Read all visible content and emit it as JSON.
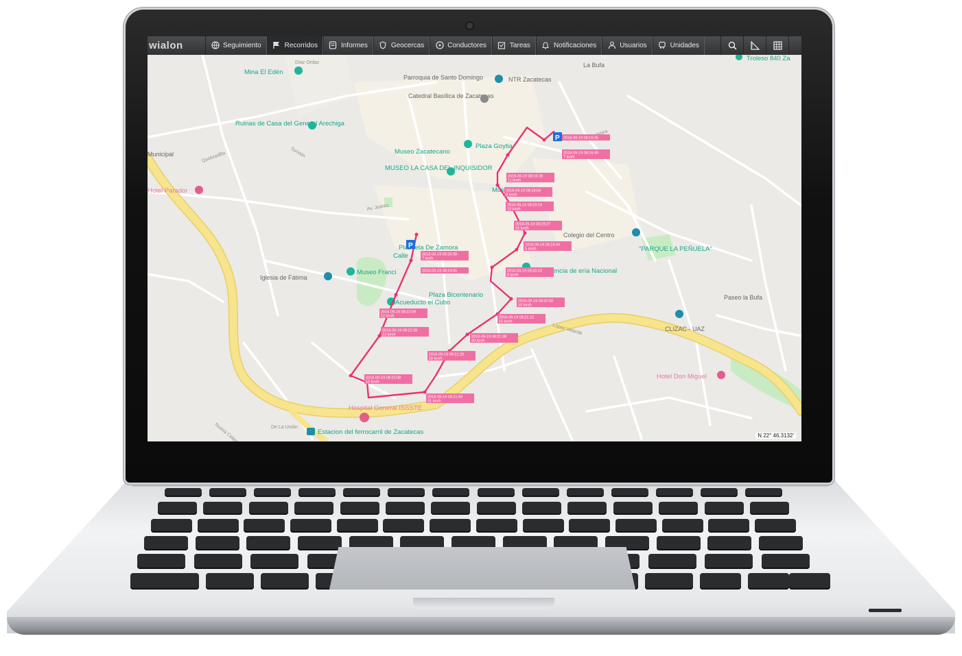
{
  "app": {
    "logo": "wialon",
    "nav": [
      {
        "label": "Seguimiento",
        "icon": "globe-icon",
        "active": false
      },
      {
        "label": "Recorridos",
        "icon": "flag-icon",
        "active": true
      },
      {
        "label": "Informes",
        "icon": "report-icon",
        "active": false
      },
      {
        "label": "Geocercas",
        "icon": "geofence-icon",
        "active": false
      },
      {
        "label": "Conductores",
        "icon": "driver-icon",
        "active": false
      },
      {
        "label": "Tareas",
        "icon": "task-icon",
        "active": false
      },
      {
        "label": "Notificaciones",
        "icon": "bell-icon",
        "active": false
      },
      {
        "label": "Usuarios",
        "icon": "user-icon",
        "active": false
      },
      {
        "label": "Unidades",
        "icon": "car-icon",
        "active": false
      }
    ],
    "tools": [
      "search-icon",
      "ruler-icon",
      "grid-icon"
    ],
    "colors": {
      "topbar": "#3a3b3d",
      "track": "#e8336f",
      "stamp": "#f06fa3",
      "road": "#f6e08a",
      "park": "#c9ebc3"
    }
  },
  "map": {
    "coordinate": "N 22° 46.3132'",
    "places": {
      "mina": "Mina El Edén",
      "diaz": "Díaz Ordaz",
      "parroquia": "Parroquia de Santo Domingo",
      "ntr": "NTR Zacatecas",
      "catedral": "Catedral Basílica de Zacatecas",
      "la_bufa": "La Bufa",
      "troleso": "Troleso 840 Za",
      "ruinas": "Ruinas de Casa del General Arechiga",
      "museo_zac": "Museo Zacatecano",
      "plaza_goytia": "Plaza Goytia",
      "museo_inq": "MUSEO LA CASA DEL INQUISIDOR",
      "museo_botica": "Museo de la Botica",
      "hotel_parador": "Hotel Parador",
      "municipal": "Municipal",
      "quebradilla": "Quebradilla",
      "torreon": "Torreón",
      "av_juarez": "Av. Juárez",
      "colegio": "Colegio del Centro",
      "parque": "\"PARQUE LA PEÑUELA\"",
      "plazuela": "Plazuela De Zamora",
      "calle": "Calle",
      "iglesia": "Iglesia de Fátima",
      "museo_fran": "Museo Franci",
      "agencia": "Agencia de ería Nacional",
      "plaza_bic": "Plaza Bicentenario",
      "acueducto": "Acueducto el Cubo",
      "paseo_bufa": "Paseo la Bufa",
      "clizac": "CLIZAC - UAZ",
      "hotel_miguel": "Hotel Don Miguel",
      "hospital": "Hospital General ISSSTE",
      "estacion": "Estacion del ferrocarril de Zacatecas",
      "la_union": "De La Unión",
      "nueva_celaya": "Nueva Celaya",
      "velarde": "López Velarde",
      "alterpalmira": "Altapalmira",
      "la_bufa_paseo": "Paseo la Bufa"
    },
    "stamps": [
      {
        "t": "2018-09-19 08:16:35",
        "s": ""
      },
      {
        "t": "2018-09-19 08:16:49",
        "s": "7 km/h"
      },
      {
        "t": "2018-09-19 08:16:28",
        "s": "11 km/h"
      },
      {
        "t": "2018-09-19 08:18:54",
        "s": "9 km/h"
      },
      {
        "t": "2018-09-19 08:19:19",
        "s": "13 km/h"
      },
      {
        "t": "2018-09-19 08:19:27",
        "s": "16 km/h"
      },
      {
        "t": "2018-09-19 08:19:59",
        "s": "5 km/h"
      },
      {
        "t": "2018-09-19 08:20:23",
        "s": "8 km/h"
      },
      {
        "t": "2018-09-19 08:24:55",
        "s": ""
      },
      {
        "t": "2018-09-19 08:26:08",
        "s": "7 km/h"
      },
      {
        "t": "2018-09-19 08:20:50",
        "s": "10 km/h"
      },
      {
        "t": "2018-09-19 08:21:12",
        "s": "15 km/h"
      },
      {
        "t": "2018-09-19 08:22:59",
        "s": "12 km/h"
      },
      {
        "t": "2018-09-19 08:21:38",
        "s": "30 km/h"
      },
      {
        "t": "2018-09-19 08:22:39",
        "s": "13 km/h"
      },
      {
        "t": "2018-09-19 08:21:29",
        "s": "18 km/h"
      },
      {
        "t": "2018-09-19 08:23:08",
        "s": "12 km/h"
      },
      {
        "t": "2018-09-19 08:21:59",
        "s": "31 km/h"
      }
    ]
  }
}
